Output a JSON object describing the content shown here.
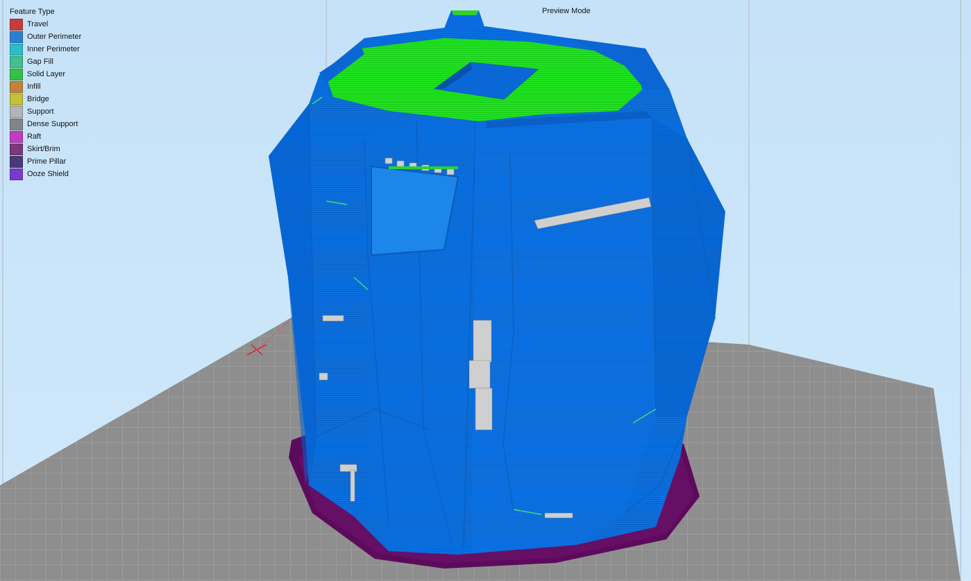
{
  "view": {
    "mode_label": "Preview Mode"
  },
  "legend": {
    "title": "Feature Type",
    "items": [
      {
        "label": "Travel",
        "color": "#c83c3c"
      },
      {
        "label": "Outer Perimeter",
        "color": "#2b7fd0"
      },
      {
        "label": "Inner Perimeter",
        "color": "#2bbcc8"
      },
      {
        "label": "Gap Fill",
        "color": "#3fc08e"
      },
      {
        "label": "Solid Layer",
        "color": "#34c045"
      },
      {
        "label": "Infill",
        "color": "#c2823a"
      },
      {
        "label": "Bridge",
        "color": "#c2c23a"
      },
      {
        "label": "Support",
        "color": "#b4b4b4"
      },
      {
        "label": "Dense Support",
        "color": "#858585"
      },
      {
        "label": "Raft",
        "color": "#c03cc0"
      },
      {
        "label": "Skirt/Brim",
        "color": "#7a3a7a"
      },
      {
        "label": "Prime Pillar",
        "color": "#4a3a7a"
      },
      {
        "label": "Ooze Shield",
        "color": "#7a3ad0"
      }
    ]
  },
  "scene_colors": {
    "model_blue": "#0a6fe0",
    "model_blue_dark": "#0559c2",
    "top_green": "#1ee01e",
    "brim_purple": "#5c0b5c",
    "bed_gray": "#8d8d8d",
    "support_gray": "#c4c4c4"
  }
}
